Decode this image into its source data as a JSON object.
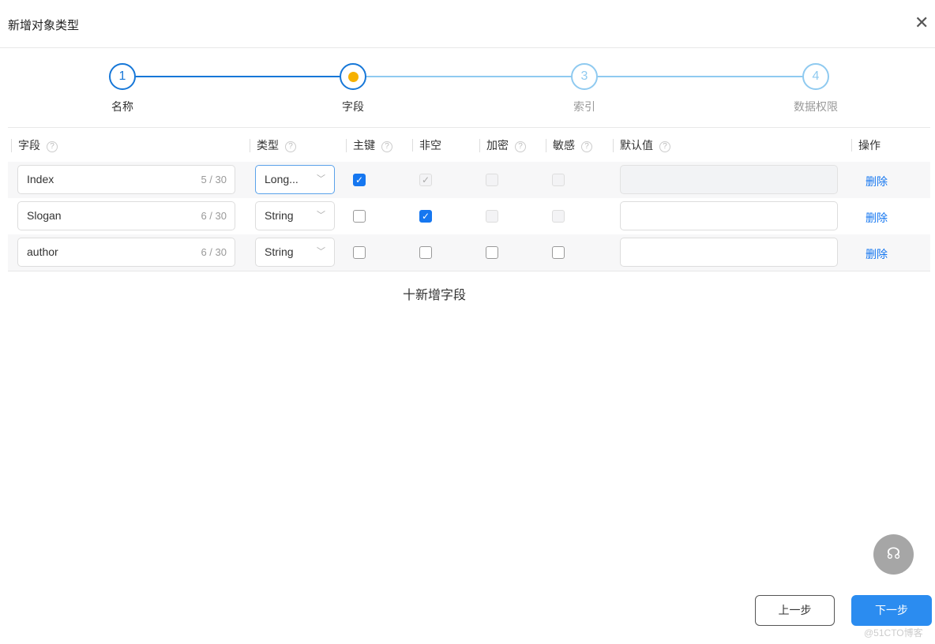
{
  "dialog": {
    "title": "新增对象类型",
    "close_icon": "close-icon"
  },
  "steps": [
    {
      "number": "1",
      "label": "名称",
      "status": "done"
    },
    {
      "number": "",
      "label": "字段",
      "status": "current"
    },
    {
      "number": "3",
      "label": "索引",
      "status": "pending"
    },
    {
      "number": "4",
      "label": "数据权限",
      "status": "pending"
    }
  ],
  "table": {
    "headers": {
      "field": "字段",
      "type": "类型",
      "primary": "主键",
      "not_null": "非空",
      "encrypt": "加密",
      "sensitive": "敏感",
      "default": "默认值",
      "action": "操作"
    },
    "rows": [
      {
        "field": "Index",
        "count": "5 / 30",
        "type": "Long...",
        "primary": true,
        "not_null": true,
        "encrypt": false,
        "sensitive": false,
        "default": "",
        "delete": "删除"
      },
      {
        "field": "Slogan",
        "count": "6 / 30",
        "type": "String",
        "primary": false,
        "not_null": true,
        "encrypt": false,
        "sensitive": false,
        "default": "",
        "delete": "删除"
      },
      {
        "field": "author",
        "count": "6 / 30",
        "type": "String",
        "primary": false,
        "not_null": false,
        "encrypt": false,
        "sensitive": false,
        "default": "",
        "delete": "删除"
      }
    ],
    "add_label": "十新增字段"
  },
  "footer": {
    "prev": "上一步",
    "next": "下一步",
    "watermark": "@51CTO博客"
  },
  "colors": {
    "primary": "#1677f0",
    "current_dot": "#f6b100",
    "pending": "#8fcaf0"
  }
}
